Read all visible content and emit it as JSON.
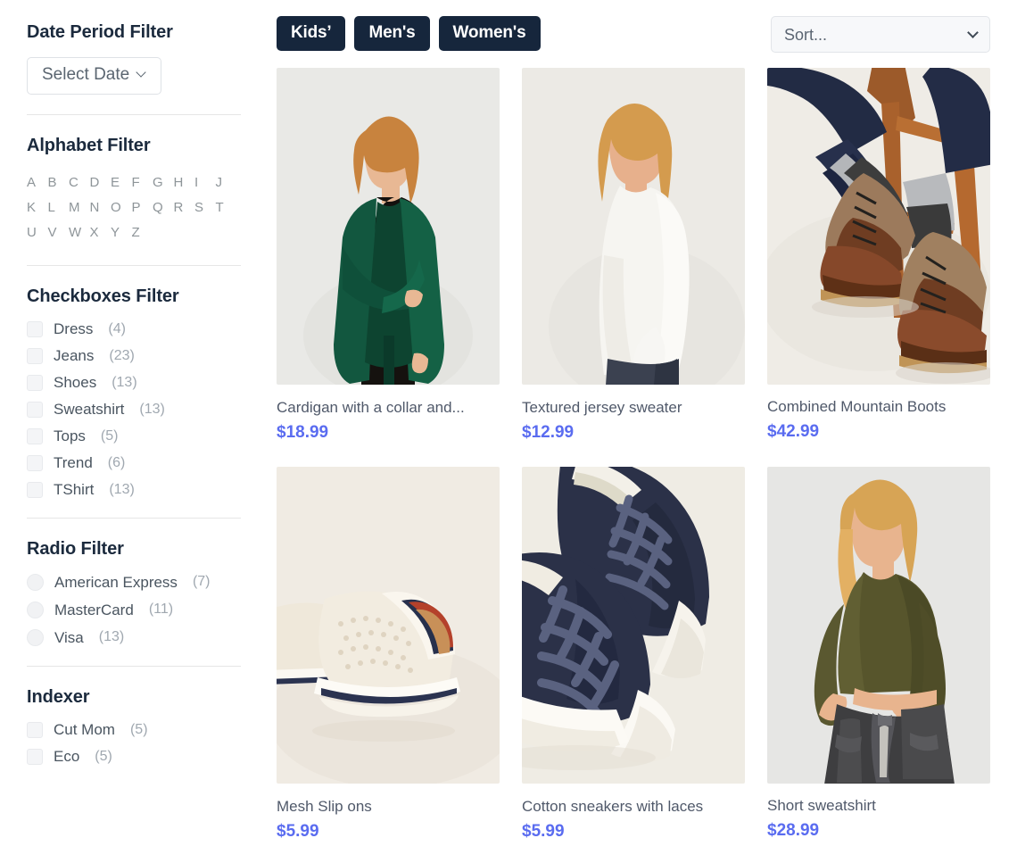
{
  "sidebar": {
    "date_filter": {
      "title": "Date Period Filter",
      "button_label": "Select Date",
      "chevron_icon": "chevron-down-icon"
    },
    "alphabet_filter": {
      "title": "Alphabet Filter",
      "letters": [
        "A",
        "B",
        "C",
        "D",
        "E",
        "F",
        "G",
        "H",
        "I",
        "J",
        "K",
        "L",
        "M",
        "N",
        "O",
        "P",
        "Q",
        "R",
        "S",
        "T",
        "U",
        "V",
        "W",
        "X",
        "Y",
        "Z"
      ]
    },
    "checkboxes_filter": {
      "title": "Checkboxes Filter",
      "items": [
        {
          "label": "Dress",
          "count": "(4)",
          "checked": false
        },
        {
          "label": "Jeans",
          "count": "(23)",
          "checked": false
        },
        {
          "label": "Shoes",
          "count": "(13)",
          "checked": false
        },
        {
          "label": "Sweatshirt",
          "count": "(13)",
          "checked": false
        },
        {
          "label": "Tops",
          "count": "(5)",
          "checked": false
        },
        {
          "label": "Trend",
          "count": "(6)",
          "checked": false
        },
        {
          "label": "TShirt",
          "count": "(13)",
          "checked": false
        }
      ]
    },
    "radio_filter": {
      "title": "Radio Filter",
      "items": [
        {
          "label": "American Express",
          "count": "(7)",
          "selected": false
        },
        {
          "label": "MasterCard",
          "count": "(11)",
          "selected": false
        },
        {
          "label": "Visa",
          "count": "(13)",
          "selected": false
        }
      ]
    },
    "indexer": {
      "title": "Indexer",
      "items": [
        {
          "label": "Cut Mom",
          "count": "(5)",
          "checked": false
        },
        {
          "label": "Eco",
          "count": "(5)",
          "checked": false
        }
      ]
    }
  },
  "toolbar": {
    "tabs": [
      {
        "label": "Kids’",
        "active": true
      },
      {
        "label": "Men's",
        "active": true
      },
      {
        "label": "Women's",
        "active": true
      }
    ],
    "sort": {
      "selected": "Sort...",
      "options": [
        "Sort..."
      ],
      "chevron_icon": "chevron-down-icon"
    }
  },
  "products": [
    {
      "title": "Cardigan with a collar and...",
      "price": "$18.99",
      "image_alt": "woman-in-dark-green-cardigan"
    },
    {
      "title": "Textured jersey sweater",
      "price": "$12.99",
      "image_alt": "woman-in-white-jersey-sweater"
    },
    {
      "title": "Combined Mountain Boots",
      "price": "$42.99",
      "image_alt": "brown-leather-mountain-boots-with-jeans"
    },
    {
      "title": "Mesh Slip ons",
      "price": "$5.99",
      "image_alt": "cream-mesh-slip-on-shoes"
    },
    {
      "title": "Cotton sneakers with laces",
      "price": "$5.99",
      "image_alt": "navy-cotton-sneakers-with-laces"
    },
    {
      "title": "Short sweatshirt",
      "price": "$28.99",
      "image_alt": "woman-in-olive-cropped-sweatshirt"
    }
  ],
  "colors": {
    "tab_background": "#16263c",
    "price_text": "#5a6cf0",
    "heading_text": "#1b2a3d",
    "muted_text": "#a0a8b0"
  }
}
